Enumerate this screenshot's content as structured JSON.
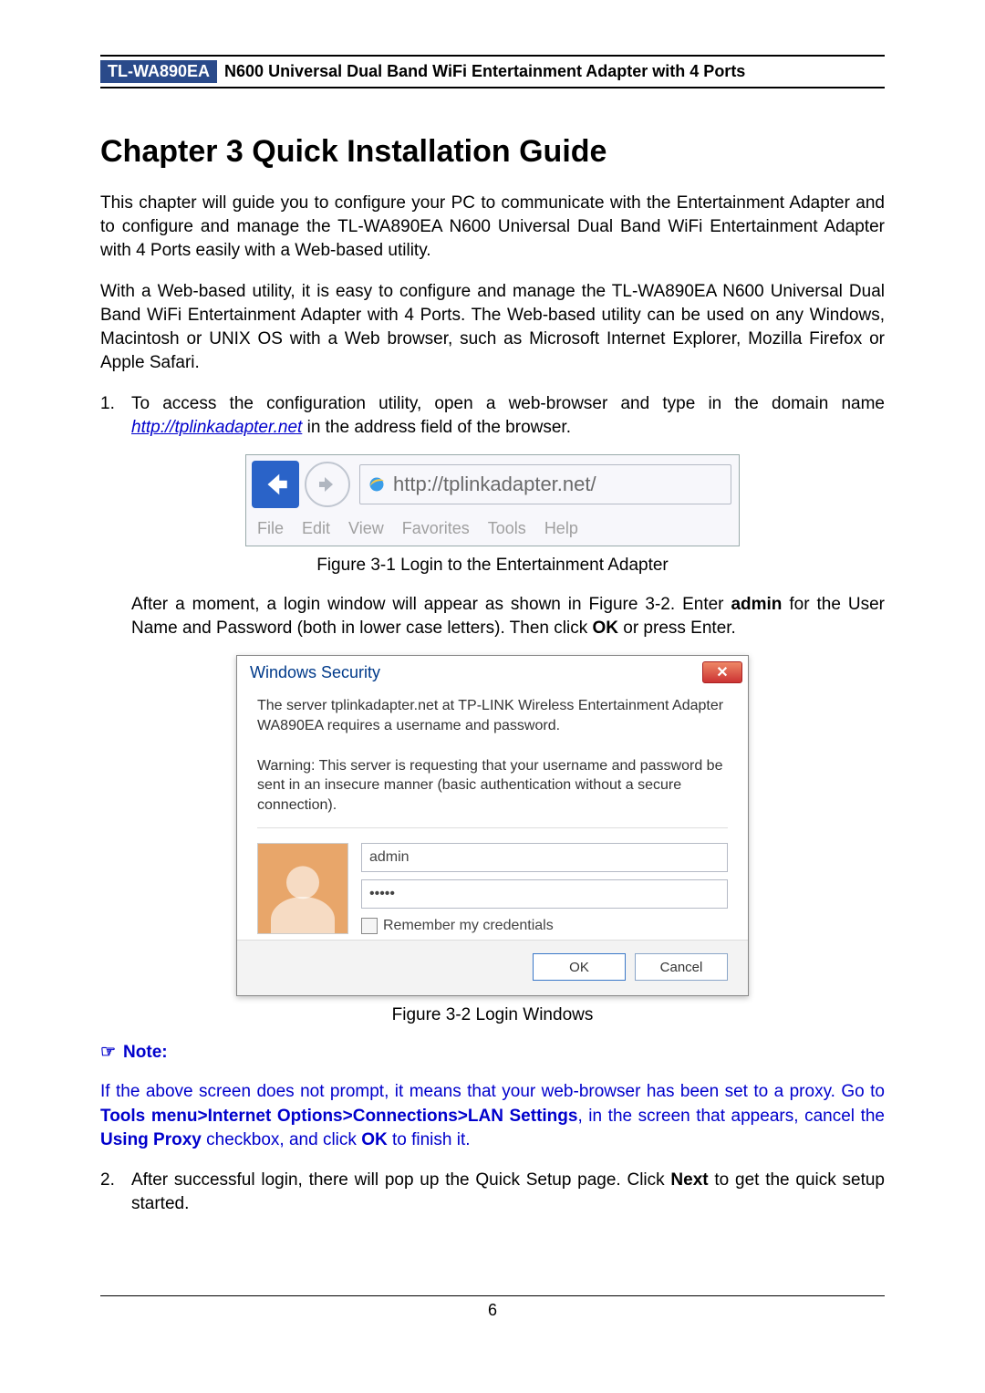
{
  "header": {
    "model": "TL-WA890EA",
    "product_desc": "N600 Universal Dual Band WiFi Entertainment Adapter with 4 Ports"
  },
  "chapter_title": "Chapter 3  Quick Installation Guide",
  "para1": "This chapter will guide you to configure your PC to communicate with the Entertainment Adapter and to configure and manage the TL-WA890EA N600 Universal Dual Band WiFi Entertainment Adapter with 4 Ports easily with a Web-based utility.",
  "para2": "With a Web-based utility, it is easy to configure and manage the TL-WA890EA N600 Universal Dual Band WiFi Entertainment Adapter with 4 Ports. The Web-based utility can be used on any Windows, Macintosh or UNIX OS with a Web browser, such as Microsoft Internet Explorer, Mozilla Firefox or Apple Safari.",
  "step1": {
    "num": "1.",
    "text_before": "To access the configuration utility, open a web-browser and type in the domain name ",
    "link": "http://tplinkadapter.net",
    "text_after": " in the address field of the browser."
  },
  "browser": {
    "url": "http://tplinkadapter.net/",
    "menu": [
      "File",
      "Edit",
      "View",
      "Favorites",
      "Tools",
      "Help"
    ]
  },
  "fig1_caption": "Figure 3-1 Login to the Entertainment Adapter",
  "after_fig1_a": "After a moment, a login window will appear as shown in Figure 3-2. Enter ",
  "after_fig1_admin": "admin",
  "after_fig1_b": " for the User Name and Password (both in lower case letters). Then click ",
  "after_fig1_ok": "OK",
  "after_fig1_c": " or press Enter.",
  "dialog": {
    "title": "Windows Security",
    "msg1": "The server tplinkadapter.net at TP-LINK Wireless Entertainment Adapter WA890EA requires a username and password.",
    "msg2": "Warning: This server is requesting that your username and password be sent in an insecure manner (basic authentication without a secure connection).",
    "username": "admin",
    "password_mask": "•••••",
    "remember": "Remember my credentials",
    "ok": "OK",
    "cancel": "Cancel"
  },
  "fig2_caption": "Figure 3-2 Login Windows",
  "note": {
    "label": "Note:",
    "body_a": "If the above screen does not prompt, it means that your web-browser has been set to a proxy. Go to ",
    "body_bold1": "Tools menu>Internet Options>Connections>LAN Settings",
    "body_b": ", in the screen that appears, cancel the ",
    "body_bold2": "Using Proxy",
    "body_c": " checkbox, and click ",
    "body_bold3": "OK",
    "body_d": " to finish it."
  },
  "step2": {
    "num": "2.",
    "text_a": "After successful login, there will pop up the Quick Setup page. Click ",
    "bold": "Next",
    "text_b": " to get the quick setup started."
  },
  "page_number": "6"
}
